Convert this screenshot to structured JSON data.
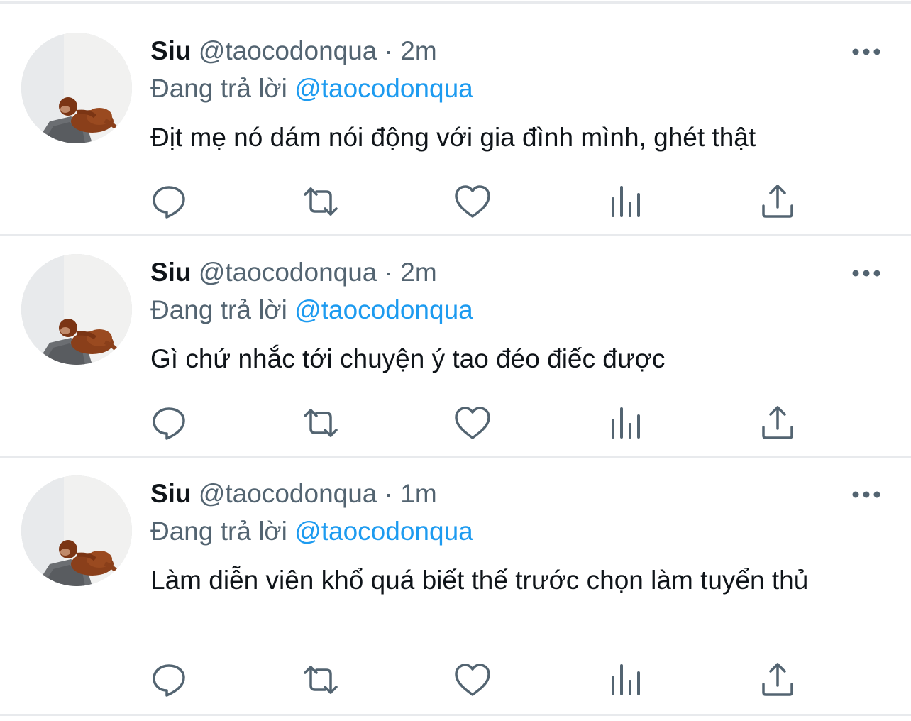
{
  "colors": {
    "text": "#0f1419",
    "secondary": "#536471",
    "link": "#1d9bf0",
    "icon": "#536471",
    "divider": "#e8eaed"
  },
  "icons": {
    "more": "more-icon",
    "reply": "reply-icon",
    "retweet": "retweet-icon",
    "like": "heart-icon",
    "analytics": "analytics-icon",
    "share": "share-icon"
  },
  "tweets": [
    {
      "display_name": "Siu",
      "handle": "@taocodonqua",
      "separator": "·",
      "time": "2m",
      "replying_prefix": "Đang trả lời",
      "replying_to": "@taocodonqua",
      "text": "Địt mẹ nó dám nói động với gia đình mình, ghét thật"
    },
    {
      "display_name": "Siu",
      "handle": "@taocodonqua",
      "separator": "·",
      "time": "2m",
      "replying_prefix": "Đang trả lời",
      "replying_to": "@taocodonqua",
      "text": "Gì chứ nhắc tới chuyện ý tao đéo điếc được"
    },
    {
      "display_name": "Siu",
      "handle": "@taocodonqua",
      "separator": "·",
      "time": "1m",
      "replying_prefix": "Đang trả lời",
      "replying_to": "@taocodonqua",
      "text": "Làm diễn viên khổ quá biết thế trước chọn làm tuyển thủ"
    }
  ]
}
